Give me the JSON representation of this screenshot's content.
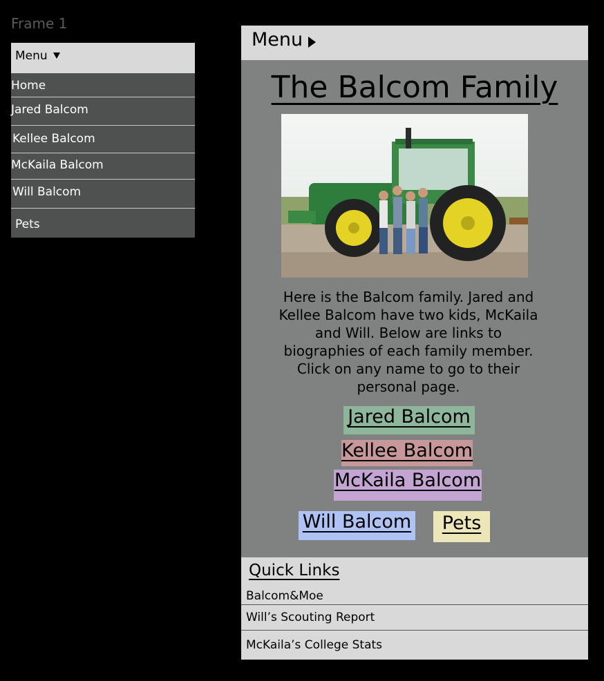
{
  "frame_label": "Frame 1",
  "dropdown": {
    "label": "Menu",
    "items": [
      {
        "label": "Home"
      },
      {
        "label": "Jared Balcom"
      },
      {
        "label": "Kellee Balcom"
      },
      {
        "label": "McKaila Balcom"
      },
      {
        "label": "Will Balcom"
      },
      {
        "label": "Pets"
      }
    ]
  },
  "phone": {
    "menu_label": "Menu",
    "title": "The Balcom Family",
    "description": "Here is the Balcom family. Jared and Kellee Balcom have two kids, McKaila and Will. Below are links to biographies of each family member. Click on any name to go to their personal page.",
    "links": [
      {
        "label": "Jared Balcom",
        "color": "#8db69a"
      },
      {
        "label": "Kellee Balcom",
        "color": "#c79799"
      },
      {
        "label": "McKaila Balcom",
        "color": "#c4a4d3"
      },
      {
        "label": "Will Balcom",
        "color": "#aec2f3"
      },
      {
        "label": "Pets",
        "color": "#ece6b8"
      }
    ],
    "quick_links": {
      "title": "Quick Links",
      "items": [
        {
          "label": "Balcom&Moe"
        },
        {
          "label": "Will’s Scouting Report"
        },
        {
          "label": "McKaila’s College Stats"
        }
      ]
    }
  }
}
